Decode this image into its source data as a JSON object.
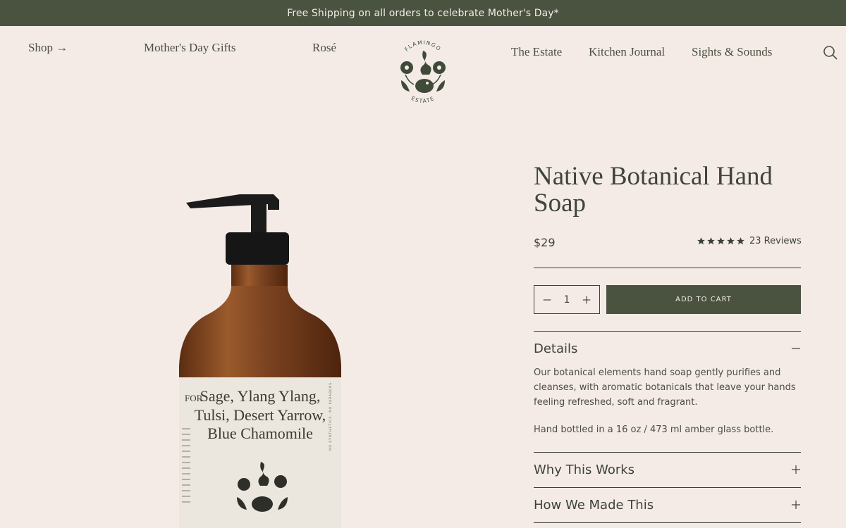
{
  "banner": {
    "text": "Free Shipping on all orders to celebrate Mother's Day*"
  },
  "nav": {
    "shop": "Shop →",
    "mothers_day": "Mother's Day Gifts",
    "rose": "Rosé",
    "estate": "The Estate",
    "journal": "Kitchen Journal",
    "sights": "Sights & Sounds"
  },
  "logo": {
    "top_text": "FLAMINGO",
    "bottom_text": "ESTATE"
  },
  "product": {
    "title": "Native Botanical Hand Soap",
    "price": "$29",
    "rating": 5,
    "reviews": "23 Reviews",
    "label_lines": [
      "Sage, Ylang Ylang,",
      "Tulsi, Desert Yarrow,",
      "Blue Chamomile"
    ],
    "label_side_left": "FOR",
    "label_side_right": "NO SYNTHETICS. NO PARABENS."
  },
  "cart": {
    "quantity": "1",
    "add_label": "ADD TO CART"
  },
  "accordion": {
    "details": {
      "title": "Details",
      "text": "Our botanical elements hand soap gently purifies and cleanses, with aromatic botanicals that leave your hands feeling refreshed, soft and fragrant.",
      "text2": "Hand bottled in a 16 oz / 473 ml amber glass bottle."
    },
    "why": {
      "title": "Why This Works"
    },
    "how": {
      "title": "How We Made This"
    }
  },
  "colors": {
    "banner": "#4a5240",
    "background": "#f4ebe6",
    "text": "#3d4238",
    "amber": "#7a4220"
  }
}
